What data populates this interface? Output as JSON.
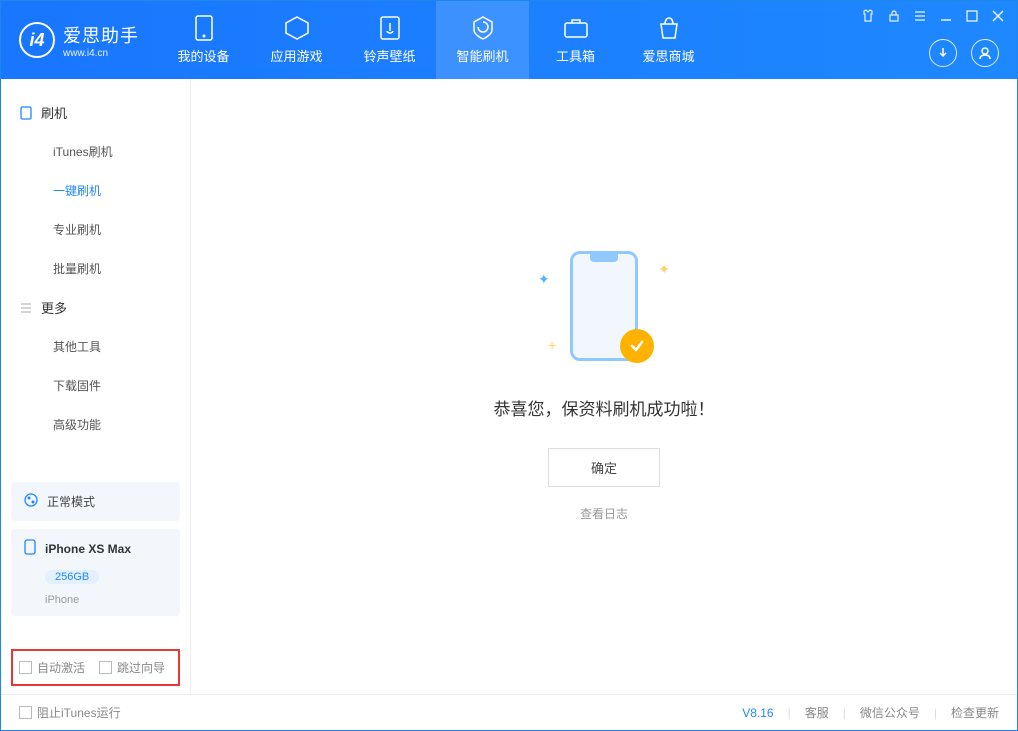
{
  "app": {
    "title": "爱思助手",
    "subtitle": "www.i4.cn"
  },
  "tabs": {
    "device": "我的设备",
    "apps": "应用游戏",
    "ring": "铃声壁纸",
    "flash": "智能刷机",
    "tools": "工具箱",
    "store": "爱思商城"
  },
  "sidebar": {
    "group_flash": "刷机",
    "items_flash": {
      "itunes": "iTunes刷机",
      "oneclick": "一键刷机",
      "pro": "专业刷机",
      "batch": "批量刷机"
    },
    "group_more": "更多",
    "items_more": {
      "other": "其他工具",
      "firmware": "下载固件",
      "advanced": "高级功能"
    }
  },
  "device": {
    "mode": "正常模式",
    "name": "iPhone XS Max",
    "storage": "256GB",
    "type": "iPhone"
  },
  "options": {
    "auto_activate": "自动激活",
    "skip_guide": "跳过向导"
  },
  "main": {
    "success_msg": "恭喜您，保资料刷机成功啦！",
    "ok": "确定",
    "view_log": "查看日志"
  },
  "footer": {
    "block_itunes": "阻止iTunes运行",
    "version": "V8.16",
    "support": "客服",
    "wechat": "微信公众号",
    "update": "检查更新"
  }
}
